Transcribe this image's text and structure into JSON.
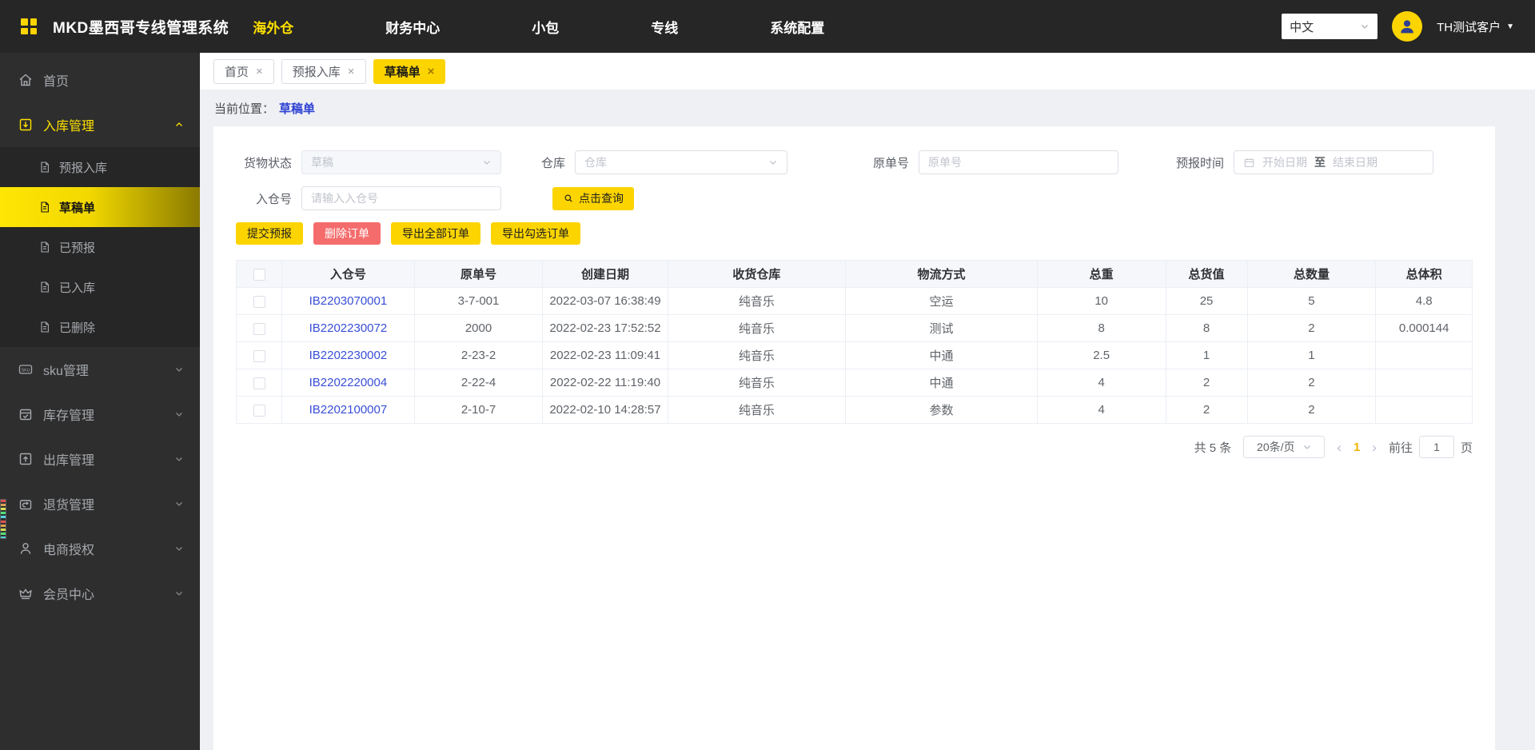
{
  "header": {
    "brand": "MKD墨西哥专线管理系统",
    "nav_items": [
      {
        "label": "海外仓",
        "active": true
      },
      {
        "label": "财务中心",
        "active": false
      },
      {
        "label": "小包",
        "active": false
      },
      {
        "label": "专线",
        "active": false
      },
      {
        "label": "系统配置",
        "active": false
      }
    ],
    "language": "中文",
    "username": "TH测试客户"
  },
  "sidebar": {
    "home": "首页",
    "inbound_group": "入库管理",
    "inbound_items": [
      "预报入库",
      "草稿单",
      "已预报",
      "已入库",
      "已删除"
    ],
    "active_item": "草稿单",
    "groups": [
      "sku管理",
      "库存管理",
      "出库管理",
      "退货管理",
      "电商授权",
      "会员中心"
    ]
  },
  "tabs": [
    {
      "label": "首页",
      "active": false
    },
    {
      "label": "预报入库",
      "active": false
    },
    {
      "label": "草稿单",
      "active": true
    }
  ],
  "breadcrumb": {
    "prefix": "当前位置：",
    "current": "草稿单"
  },
  "filters": {
    "cargo_status": {
      "label": "货物状态",
      "value": "草稿",
      "disabled": true
    },
    "warehouse": {
      "label": "仓库",
      "placeholder": "仓库"
    },
    "original_no": {
      "label": "原单号",
      "placeholder": "原单号"
    },
    "forecast_time": {
      "label": "预报时间",
      "start_placeholder": "开始日期",
      "separator": "至",
      "end_placeholder": "结束日期"
    },
    "inbound_no": {
      "label": "入仓号",
      "placeholder": "请输入入仓号"
    },
    "search_button": "点击查询"
  },
  "actions": {
    "submit": "提交预报",
    "delete": "删除订单",
    "export_all": "导出全部订单",
    "export_selected": "导出勾选订单"
  },
  "table": {
    "columns": [
      "入仓号",
      "原单号",
      "创建日期",
      "收货仓库",
      "物流方式",
      "总重",
      "总货值",
      "总数量",
      "总体积"
    ],
    "rows": [
      {
        "inbound_no": "IB2203070001",
        "original_no": "3-7-001",
        "created": "2022-03-07 16:38:49",
        "warehouse": "纯音乐",
        "logistics": "空运",
        "weight": "10",
        "value": "25",
        "qty": "5",
        "volume": "4.8"
      },
      {
        "inbound_no": "IB2202230072",
        "original_no": "2000",
        "created": "2022-02-23 17:52:52",
        "warehouse": "纯音乐",
        "logistics": "测试",
        "weight": "8",
        "value": "8",
        "qty": "2",
        "volume": "0.000144"
      },
      {
        "inbound_no": "IB2202230002",
        "original_no": "2-23-2",
        "created": "2022-02-23 11:09:41",
        "warehouse": "纯音乐",
        "logistics": "中通",
        "weight": "2.5",
        "value": "1",
        "qty": "1",
        "volume": ""
      },
      {
        "inbound_no": "IB2202220004",
        "original_no": "2-22-4",
        "created": "2022-02-22 11:19:40",
        "warehouse": "纯音乐",
        "logistics": "中通",
        "weight": "4",
        "value": "2",
        "qty": "2",
        "volume": ""
      },
      {
        "inbound_no": "IB2202100007",
        "original_no": "2-10-7",
        "created": "2022-02-10 14:28:57",
        "warehouse": "纯音乐",
        "logistics": "参数",
        "weight": "4",
        "value": "2",
        "qty": "2",
        "volume": ""
      }
    ]
  },
  "pagination": {
    "total": "共 5 条",
    "page_size": "20条/页",
    "current_page": "1",
    "jump_prefix": "前往",
    "jump_value": "1",
    "jump_suffix": "页"
  },
  "icons": {
    "close": "×",
    "prev": "‹",
    "next": "›",
    "caret_down": "▼"
  },
  "colors": {
    "accent": "#fcd400",
    "nav_active": "#ffe100",
    "danger": "#f56c6c",
    "link": "#3a4fd6",
    "page_current": "#efb400"
  }
}
